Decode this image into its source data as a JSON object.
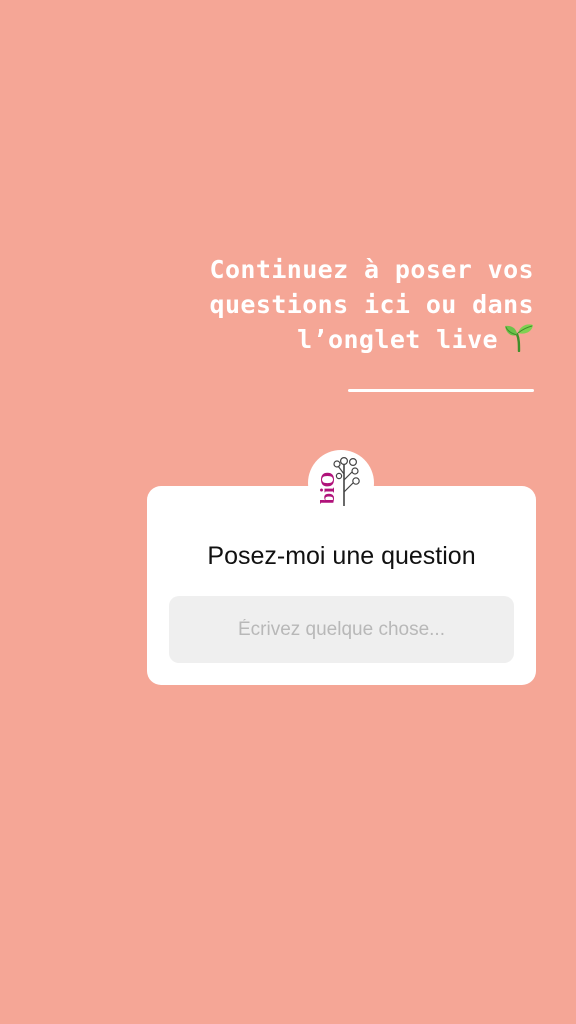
{
  "story": {
    "background_color": "#f5a696",
    "caption": {
      "line1": "Continuez à poser vos",
      "line2": "questions ici ou dans",
      "line3": "l’onglet live",
      "emoji_icon": "seedling-icon"
    }
  },
  "question_sticker": {
    "avatar_logo": "biO",
    "title": "Posez-moi une question",
    "input_placeholder": "Écrivez quelque chose..."
  }
}
